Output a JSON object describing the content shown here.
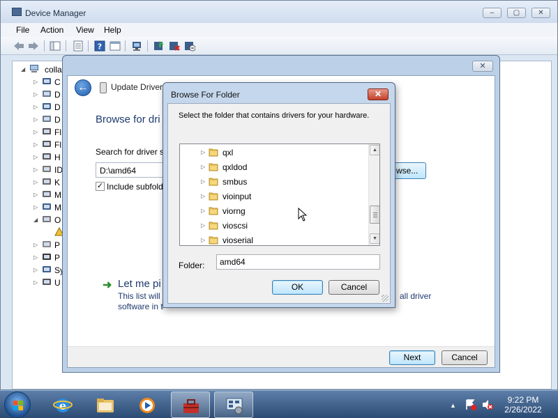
{
  "device_manager": {
    "title": "Device Manager",
    "window_buttons": [
      "–",
      "▢",
      "✕"
    ],
    "menu": [
      "File",
      "Action",
      "View",
      "Help"
    ],
    "tree_root": "collab",
    "tree_items": [
      "C",
      "D",
      "D",
      "D",
      "Fl",
      "Fl",
      "H",
      "ID",
      "K",
      "M",
      "M",
      "O",
      "",
      "P",
      "P",
      "Sy",
      "U"
    ]
  },
  "update_driver": {
    "header": "Update Driver",
    "heading": "Browse for dri",
    "search_label": "Search for driver so",
    "path_value": "D:\\amd64",
    "browse_label": "wse...",
    "include_subfolders_label": "Include subfold",
    "include_subfolders_checked": true,
    "let_me_pick": "Let me pi",
    "desc_line1_left": "This list will",
    "desc_line1_right": "all driver",
    "desc_line2": "software in t",
    "next_label": "Next",
    "cancel_label": "Cancel",
    "close_glyph": "✕"
  },
  "browse_folder": {
    "title": "Browse For Folder",
    "message": "Select the folder that contains drivers for your hardware.",
    "folders": [
      "qxl",
      "qxldod",
      "smbus",
      "vioinput",
      "viorng",
      "vioscsi",
      "vioserial"
    ],
    "folder_label": "Folder:",
    "folder_value": "amd64",
    "ok_label": "OK",
    "cancel_label": "Cancel",
    "close_glyph": "✕"
  },
  "taskbar": {
    "time": "9:22 PM",
    "date": "2/26/2022",
    "apps": [
      "internet-explorer",
      "windows-explorer",
      "media-player",
      "toolbox",
      "device-manager"
    ]
  }
}
